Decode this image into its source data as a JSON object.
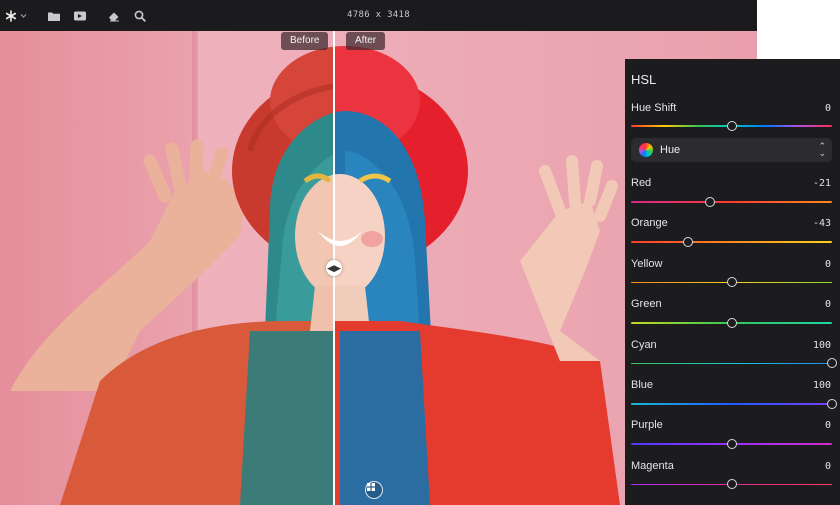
{
  "toolbar": {
    "app_icon": "asterisk-logo-icon",
    "app_menu_icon": "chevron-down-icon",
    "buttons": [
      {
        "icon": "folder-icon"
      },
      {
        "icon": "image-export-icon"
      },
      {
        "icon": "eraser-icon"
      },
      {
        "icon": "magnifier-icon"
      }
    ],
    "dimensions": "4786 x 3418"
  },
  "compare": {
    "before_label": "Before",
    "after_label": "After",
    "handle_icon": "split-arrows-icon",
    "reset_icon": "grid-button-icon",
    "position": 0.44
  },
  "hsl": {
    "title": "HSL",
    "hue_shift": {
      "label": "Hue Shift",
      "value": "0",
      "fraction": 0.5
    },
    "mode_select": {
      "value": "Hue",
      "icon": "color-wheel-icon"
    },
    "channels": [
      {
        "label": "Red",
        "value": "-21",
        "fraction": 0.395
      },
      {
        "label": "Orange",
        "value": "-43",
        "fraction": 0.285
      },
      {
        "label": "Yellow",
        "value": "0",
        "fraction": 0.5
      },
      {
        "label": "Green",
        "value": "0",
        "fraction": 0.5
      },
      {
        "label": "Cyan",
        "value": "100",
        "fraction": 1.0
      },
      {
        "label": "Blue",
        "value": "100",
        "fraction": 1.0
      },
      {
        "label": "Purple",
        "value": "0",
        "fraction": 0.5
      },
      {
        "label": "Magenta",
        "value": "0",
        "fraction": 0.5
      }
    ]
  },
  "colors": {
    "panel_bg": "#1c1c1e",
    "toolbar_bg": "#1b1b1d",
    "accent_before": "#d6584a",
    "accent_after": "#e8202e"
  }
}
